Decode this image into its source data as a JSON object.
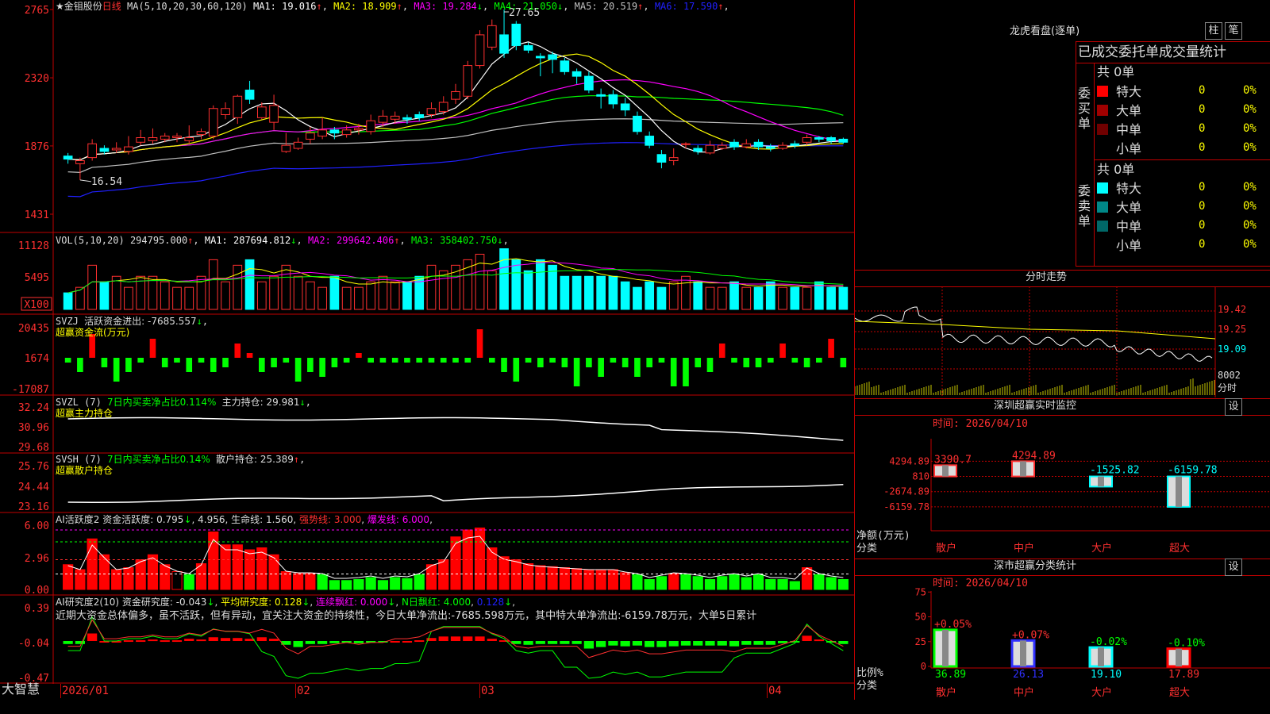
{
  "stock": {
    "name": "★金钼股份",
    "period": "日线",
    "ma_label": "MA(5,10,20,30,60,120)",
    "ma_values": [
      {
        "t": "MA1: 19.016",
        "arrow": "↑",
        "color": "#ffffff"
      },
      {
        "t": "MA2: 18.909",
        "arrow": "↑",
        "color": "#ffff00"
      },
      {
        "t": "MA3: 19.284",
        "arrow": "↓",
        "color": "#ff00ff"
      },
      {
        "t": "MA4: 21.050",
        "arrow": "↓",
        "color": "#00ff00"
      },
      {
        "t": "MA5: 20.519",
        "arrow": "↑",
        "color": "#c0c0c0"
      },
      {
        "t": "MA6: 17.590",
        "arrow": "↑",
        "color": "#2020ff"
      }
    ],
    "high_label": "27.65",
    "low_label": "16.54",
    "price_axis": [
      "2765",
      "2320",
      "1876",
      "1431"
    ]
  },
  "vol": {
    "label": "VOL(5,10,20)",
    "value": "294795.000",
    "arrow": "↑",
    "ma": [
      {
        "t": "MA1: 287694.812",
        "arrow": "↓",
        "color": "#ffffff"
      },
      {
        "t": "MA2: 299642.406",
        "arrow": "↑",
        "color": "#ff00ff"
      },
      {
        "t": "MA3: 358402.750",
        "arrow": "↓",
        "color": "#00ff00"
      }
    ],
    "axis": [
      "11128",
      "5495"
    ],
    "unit": "X100"
  },
  "svzj": {
    "label": "SVZJ",
    "desc": "活跃资金进出: -7685.557",
    "arrow": "↓",
    "sub": "超赢资金流(万元)",
    "axis": [
      "20435",
      "1674",
      "-17087"
    ]
  },
  "svzl": {
    "label": "SVZL (7)",
    "desc": "7日内买卖净占比0.114%",
    "desc2": "主力持仓: 29.981",
    "arrow": "↓",
    "sub": "超赢主力持仓",
    "axis": [
      "32.24",
      "30.96",
      "29.68"
    ]
  },
  "svsh": {
    "label": "SVSH (7)",
    "desc": "7日内买卖净占比0.14%",
    "desc2": "散户持仓: 25.389",
    "arrow": "↑",
    "sub": "超赢散户持仓",
    "axis": [
      "25.76",
      "24.44",
      "23.16"
    ]
  },
  "ai1": {
    "label": "AI活跃度2",
    "desc": "资金活跃度: 0.795",
    "a1": "↓",
    "v2": "4.956",
    "desc3": "生命线: 1.560",
    "strong": "强势线: 3.000",
    "burst": "爆发线: 6.000",
    "axis": [
      "6.00",
      "2.96",
      "0.00"
    ]
  },
  "ai2": {
    "label": "AI研究度2(10)",
    "desc": "资金研究度: -0.043",
    "a1": "↓",
    "avg": "平均研究度: 0.128",
    "a2": "↓",
    "cont": "连续飘红: 0.000",
    "a3": "↓",
    "nday": "N日飘红: 4.000",
    "v5": "0.128",
    "a5": "↓",
    "axis": [
      "0.39",
      "-0.04",
      "-0.47"
    ],
    "commentary": "近期大资金总体偏多，虽不活跃，但有异动，宜关注大资金的持续性，今日大单净流出:-7685.598万元，其中特大单净流出:-6159.78万元，大单5日累计"
  },
  "bottom": {
    "brand": "大智慧",
    "dates": [
      "2026/01",
      "02",
      "03",
      "04"
    ]
  },
  "right": {
    "dragon_title": "龙虎看盘(逐单)",
    "btn1": "柱",
    "btn2": "笔",
    "order_title": "已成交委托单成交量统计",
    "buy_label": "委买单",
    "sell_label": "委卖单",
    "buy_total": "共 0单",
    "sell_total": "共 0单",
    "buy_rows": [
      {
        "name": "特大",
        "v": "0",
        "p": "0%",
        "c": "#ff0000"
      },
      {
        "name": "大单",
        "v": "0",
        "p": "0%",
        "c": "#a00000"
      },
      {
        "name": "中单",
        "v": "0",
        "p": "0%",
        "c": "#700000"
      },
      {
        "name": "小单",
        "v": "0",
        "p": "0%",
        "c": ""
      }
    ],
    "sell_rows": [
      {
        "name": "特大",
        "v": "0",
        "p": "0%",
        "c": "#00ffff"
      },
      {
        "name": "大单",
        "v": "0",
        "p": "0%",
        "c": "#008888"
      },
      {
        "name": "中单",
        "v": "0",
        "p": "0%",
        "c": "#006868"
      },
      {
        "name": "小单",
        "v": "0",
        "p": "0%",
        "c": ""
      }
    ],
    "tick_title": "分时走势",
    "tick_axis": [
      "19.42",
      "19.25",
      "19.09"
    ],
    "tick_vol": "8002",
    "tick_vol_unit": "分时",
    "monitor_title": "深圳超赢实时监控",
    "monitor_set": "设",
    "monitor_time": "时间: 2026/04/10",
    "monitor_axis": [
      "4294.89",
      "810",
      "-2674.89",
      "-6159.78"
    ],
    "monitor_ylabel": "净额(万元)",
    "monitor_xlabel": "分类",
    "monitor_bars": [
      {
        "cat": "散户",
        "label": "3390.7",
        "v": 3390.7
      },
      {
        "cat": "中户",
        "label": "4294.89",
        "v": 4294.89
      },
      {
        "cat": "大户",
        "label": "-1525.82",
        "v": -1525.82
      },
      {
        "cat": "超大",
        "label": "-6159.78",
        "v": -6159.78
      }
    ],
    "class_title": "深市超赢分类统计",
    "class_set": "设",
    "class_time": "时间: 2026/04/10",
    "class_axis": [
      "75",
      "50",
      "25",
      "0"
    ],
    "class_ylabel": "比例%",
    "class_xlabel": "分类",
    "class_bars": [
      {
        "cat": "散户",
        "top": "+0.05%",
        "v": 36.89,
        "label": "36.89",
        "color": "#00ff00"
      },
      {
        "cat": "中户",
        "top": "+0.07%",
        "v": 26.13,
        "label": "26.13",
        "color": "#3030ff"
      },
      {
        "cat": "大户",
        "top": "-0.02%",
        "v": 19.1,
        "label": "19.10",
        "color": "#00ffff"
      },
      {
        "cat": "超大",
        "top": "-0.10%",
        "v": 17.89,
        "label": "17.89",
        "color": "#ff0000"
      }
    ]
  },
  "chart_data": {
    "type": "candlestick",
    "title": "金钼股份 日线",
    "candles": [
      {
        "o": 18.1,
        "c": 17.9,
        "h": 18.3,
        "l": 17.6
      },
      {
        "o": 17.6,
        "c": 17.8,
        "h": 18.0,
        "l": 16.54
      },
      {
        "o": 18.0,
        "c": 18.9,
        "h": 19.2,
        "l": 17.8
      },
      {
        "o": 18.6,
        "c": 18.4,
        "h": 18.8,
        "l": 18.2
      },
      {
        "o": 18.5,
        "c": 18.6,
        "h": 19.0,
        "l": 18.3
      },
      {
        "o": 18.4,
        "c": 18.7,
        "h": 19.4,
        "l": 18.2
      },
      {
        "o": 19.0,
        "c": 19.3,
        "h": 19.8,
        "l": 18.8
      },
      {
        "o": 19.1,
        "c": 19.3,
        "h": 19.9,
        "l": 18.9
      },
      {
        "o": 19.2,
        "c": 19.4,
        "h": 19.6,
        "l": 19.0
      },
      {
        "o": 19.3,
        "c": 19.4,
        "h": 19.6,
        "l": 19.0
      },
      {
        "o": 19.1,
        "c": 19.3,
        "h": 20.1,
        "l": 18.9
      },
      {
        "o": 19.5,
        "c": 19.7,
        "h": 19.9,
        "l": 19.2
      },
      {
        "o": 19.4,
        "c": 21.2,
        "h": 21.4,
        "l": 19.2
      },
      {
        "o": 20.8,
        "c": 21.2,
        "h": 21.6,
        "l": 20.5
      },
      {
        "o": 20.6,
        "c": 22.0,
        "h": 22.1,
        "l": 20.2
      },
      {
        "o": 22.4,
        "c": 21.8,
        "h": 23.0,
        "l": 21.5
      },
      {
        "o": 20.6,
        "c": 21.3,
        "h": 21.6,
        "l": 20.5
      },
      {
        "o": 20.3,
        "c": 21.4,
        "h": 22.1,
        "l": 19.8
      },
      {
        "o": 18.4,
        "c": 18.8,
        "h": 19.6,
        "l": 18.3
      },
      {
        "o": 18.6,
        "c": 19.0,
        "h": 19.3,
        "l": 18.5
      },
      {
        "o": 19.2,
        "c": 19.6,
        "h": 20.0,
        "l": 18.9
      },
      {
        "o": 19.4,
        "c": 19.8,
        "h": 20.6,
        "l": 19.2
      },
      {
        "o": 19.8,
        "c": 19.6,
        "h": 20.0,
        "l": 19.2
      },
      {
        "o": 19.5,
        "c": 19.8,
        "h": 20.1,
        "l": 19.3
      },
      {
        "o": 19.8,
        "c": 19.9,
        "h": 20.2,
        "l": 19.5
      },
      {
        "o": 19.7,
        "c": 20.4,
        "h": 20.8,
        "l": 19.5
      },
      {
        "o": 20.3,
        "c": 20.7,
        "h": 21.1,
        "l": 20.0
      },
      {
        "o": 20.5,
        "c": 20.7,
        "h": 21.0,
        "l": 20.2
      },
      {
        "o": 20.6,
        "c": 20.5,
        "h": 20.8,
        "l": 20.2
      },
      {
        "o": 20.8,
        "c": 20.6,
        "h": 21.0,
        "l": 20.4
      },
      {
        "o": 20.8,
        "c": 21.2,
        "h": 21.6,
        "l": 20.6
      },
      {
        "o": 21.0,
        "c": 21.6,
        "h": 22.0,
        "l": 20.8
      },
      {
        "o": 21.8,
        "c": 22.3,
        "h": 22.8,
        "l": 21.5
      },
      {
        "o": 22.0,
        "c": 24.0,
        "h": 24.3,
        "l": 21.8
      },
      {
        "o": 24.0,
        "c": 26.0,
        "h": 26.3,
        "l": 23.8
      },
      {
        "o": 25.2,
        "c": 26.6,
        "h": 27.0,
        "l": 25.0
      },
      {
        "o": 26.0,
        "c": 24.8,
        "h": 27.65,
        "l": 24.5
      },
      {
        "o": 26.7,
        "c": 25.3,
        "h": 26.9,
        "l": 25.0
      },
      {
        "o": 25.3,
        "c": 25.0,
        "h": 25.5,
        "l": 24.8
      },
      {
        "o": 24.6,
        "c": 24.5,
        "h": 24.8,
        "l": 23.3
      },
      {
        "o": 24.7,
        "c": 24.4,
        "h": 24.9,
        "l": 23.5
      },
      {
        "o": 24.3,
        "c": 23.6,
        "h": 24.5,
        "l": 23.4
      },
      {
        "o": 23.6,
        "c": 23.3,
        "h": 23.8,
        "l": 22.8
      },
      {
        "o": 23.3,
        "c": 22.4,
        "h": 23.6,
        "l": 22.2
      },
      {
        "o": 22.1,
        "c": 22.0,
        "h": 22.5,
        "l": 21.2
      },
      {
        "o": 22.1,
        "c": 21.5,
        "h": 22.4,
        "l": 21.2
      },
      {
        "o": 21.5,
        "c": 21.1,
        "h": 21.9,
        "l": 20.7
      },
      {
        "o": 20.7,
        "c": 19.7,
        "h": 21.0,
        "l": 19.5
      },
      {
        "o": 19.4,
        "c": 18.8,
        "h": 19.7,
        "l": 18.6
      },
      {
        "o": 18.2,
        "c": 17.7,
        "h": 18.5,
        "l": 17.3
      },
      {
        "o": 17.8,
        "c": 18.0,
        "h": 18.6,
        "l": 17.5
      },
      {
        "o": 18.9,
        "c": 18.9,
        "h": 19.0,
        "l": 18.6
      },
      {
        "o": 18.6,
        "c": 18.4,
        "h": 18.8,
        "l": 18.2
      },
      {
        "o": 18.3,
        "c": 18.8,
        "h": 19.1,
        "l": 18.2
      },
      {
        "o": 18.6,
        "c": 18.8,
        "h": 19.0,
        "l": 18.5
      },
      {
        "o": 19.0,
        "c": 18.7,
        "h": 19.2,
        "l": 18.5
      },
      {
        "o": 18.7,
        "c": 18.9,
        "h": 19.2,
        "l": 18.6
      },
      {
        "o": 19.0,
        "c": 18.7,
        "h": 19.2,
        "l": 18.5
      },
      {
        "o": 18.7,
        "c": 18.6,
        "h": 18.9,
        "l": 18.4
      },
      {
        "o": 18.6,
        "c": 18.8,
        "h": 19.0,
        "l": 18.5
      },
      {
        "o": 18.9,
        "c": 18.8,
        "h": 19.1,
        "l": 18.6
      },
      {
        "o": 19.0,
        "c": 19.3,
        "h": 19.5,
        "l": 18.8
      },
      {
        "o": 19.3,
        "c": 19.2,
        "h": 19.4,
        "l": 19.0
      },
      {
        "o": 19.3,
        "c": 19.1,
        "h": 19.4,
        "l": 18.9
      },
      {
        "o": 19.2,
        "c": 19.0,
        "h": 19.3,
        "l": 18.9
      }
    ],
    "volume": [
      3,
      4,
      8,
      5,
      6,
      4,
      6,
      6,
      5,
      4,
      4,
      6,
      9,
      5,
      8,
      9,
      5,
      6,
      8,
      6,
      5,
      4,
      6,
      4,
      4,
      5,
      6,
      5,
      5,
      6,
      8,
      7,
      8,
      9,
      10,
      7,
      11,
      9,
      7,
      9,
      8,
      6,
      6,
      6,
      6,
      6,
      5,
      4,
      5,
      4,
      5,
      6,
      5,
      4,
      4,
      5,
      4,
      4,
      5,
      4,
      4,
      4,
      5,
      4,
      4
    ],
    "ylim": [
      14.31,
      27.65
    ]
  }
}
